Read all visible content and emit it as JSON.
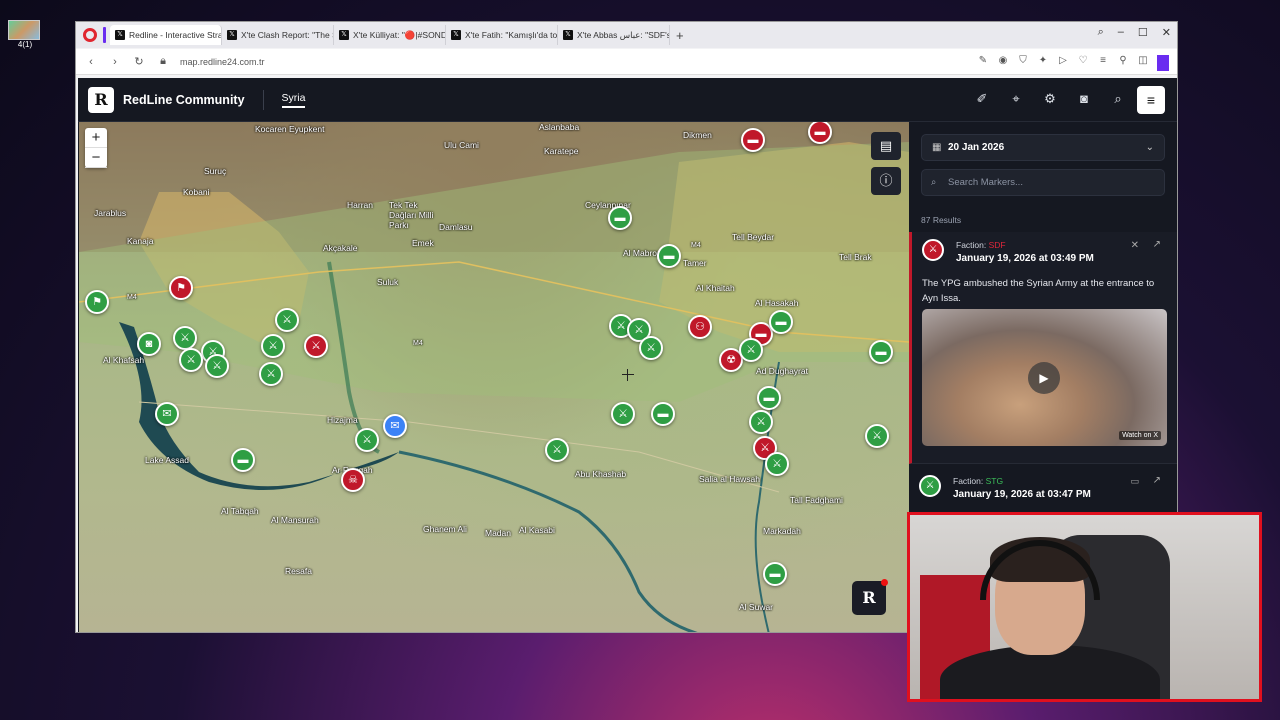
{
  "desktop": {
    "icon_label": "4(1)"
  },
  "browser": {
    "tabs": [
      {
        "label": "Redline - Interactive Strate",
        "active": true,
        "icon": "x-logo-icon"
      },
      {
        "label": "X'te Clash Report: \"The Sy",
        "icon": "x-logo-icon"
      },
      {
        "label": "X'te Külliyat: \"🔴|#SOND",
        "icon": "x-logo-icon"
      },
      {
        "label": "X'te Fatih: \"Kamışlı'da top",
        "icon": "x-logo-icon"
      },
      {
        "label": "X'te Abbas عباس: \"SDF's w",
        "icon": "x-logo-icon"
      }
    ],
    "url": "map.redline24.com.tr"
  },
  "app": {
    "brand": "RedLine Community",
    "logo_letter": "R",
    "country": "Syria"
  },
  "map": {
    "places": [
      {
        "name": "Kocaren"
      },
      {
        "name": "Eyupkent"
      },
      {
        "name": "Ulu Cami"
      },
      {
        "name": "Suruç"
      },
      {
        "name": "Kobani"
      },
      {
        "name": "Jarablus"
      },
      {
        "name": "Kanaja"
      },
      {
        "name": "Harran"
      },
      {
        "name": "Tek Tek Dağları Milli Parkı"
      },
      {
        "name": "Damlasu"
      },
      {
        "name": "Emek"
      },
      {
        "name": "Akçakale"
      },
      {
        "name": "Suluk"
      },
      {
        "name": "Aslanbaba"
      },
      {
        "name": "Karatepe"
      },
      {
        "name": "Ceylanpınar"
      },
      {
        "name": "Al Mabrouka"
      },
      {
        "name": "Tamer"
      },
      {
        "name": "Dikmen"
      },
      {
        "name": "Tell Beydar"
      },
      {
        "name": "Tell Brak"
      },
      {
        "name": "Al Khafsah"
      },
      {
        "name": "Hizajma"
      },
      {
        "name": "Lake Assad"
      },
      {
        "name": "Al Tabqah"
      },
      {
        "name": "Al Mansurah"
      },
      {
        "name": "Ghanem Ali"
      },
      {
        "name": "Abu Khashab"
      },
      {
        "name": "Salia al Hawsah"
      },
      {
        "name": "Tall Fadghami"
      },
      {
        "name": "Markadah"
      },
      {
        "name": "Al Kasabi"
      },
      {
        "name": "Madan"
      },
      {
        "name": "Resafa"
      },
      {
        "name": "Al Suwar"
      },
      {
        "name": "Ad Dughayrat"
      },
      {
        "name": "Al Khaitah"
      },
      {
        "name": "Ar Raqqah"
      },
      {
        "name": "Al Hasakah"
      }
    ],
    "road_labels": [
      "M4",
      "M4",
      "M4"
    ]
  },
  "sidebar": {
    "date": "20 Jan 2026",
    "search_placeholder": "Search Markers...",
    "results": "87 Results",
    "cards": [
      {
        "faction_label": "Faction: ",
        "faction": "SDF",
        "time": "January 19, 2026 at 03:49 PM",
        "description": "The YPG ambushed the Syrian Army at the entrance to Ayn Issa.",
        "video_caption": "Watch on X"
      },
      {
        "faction_label": "Faction: ",
        "faction": "STG",
        "time": "January 19, 2026 at 03:47 PM"
      }
    ]
  },
  "colors": {
    "sdf": "#c0182a",
    "stg": "#2f9e44",
    "accent": "#6a2cf0"
  }
}
